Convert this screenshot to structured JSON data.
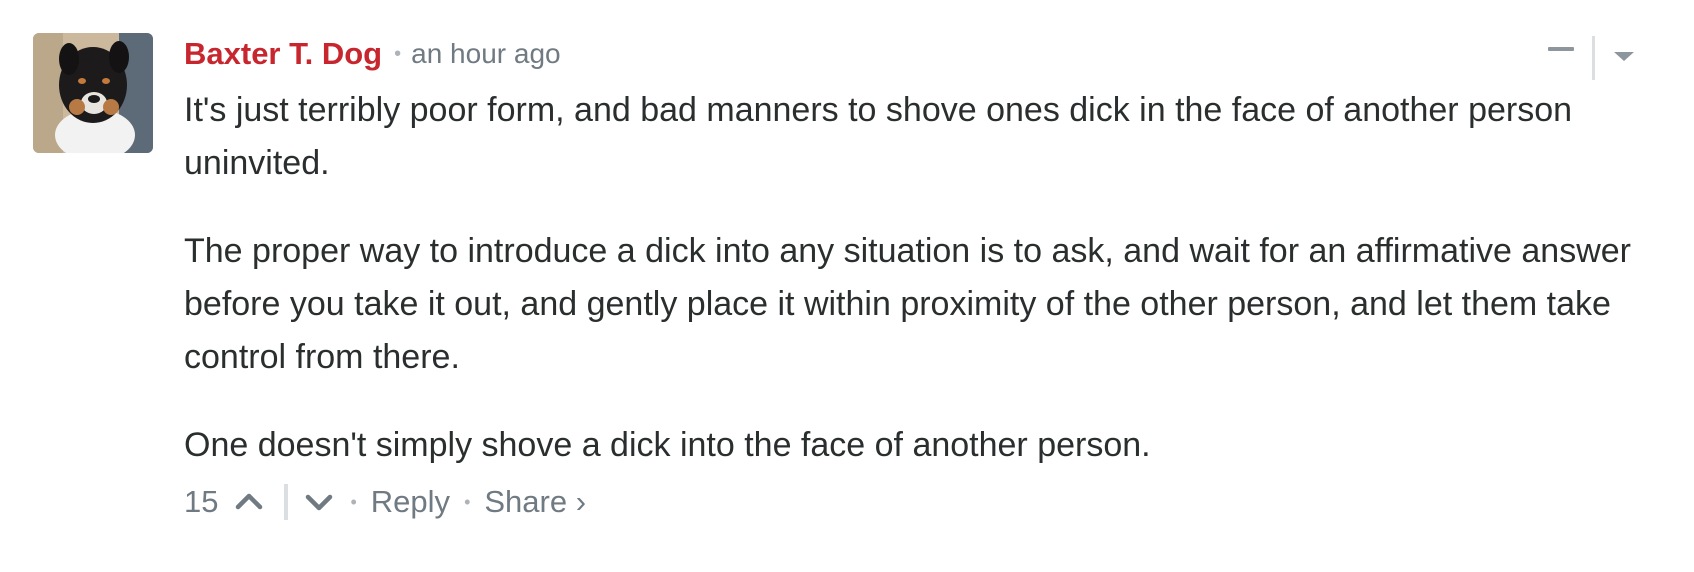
{
  "comment": {
    "author": "Baxter T. Dog",
    "separator": "•",
    "timestamp": "an hour ago",
    "paragraphs": [
      "It's just terribly poor form, and bad manners to shove ones dick in the face of another person uninvited.",
      "The proper way to introduce a dick into any situation is to ask, and wait for an affirmative answer before you take it out, and gently place it within proximity of the other person, and let them take control from there.",
      "One doesn't simply shove a dick into the face of another person."
    ],
    "footer": {
      "upvotes": "15",
      "dot": "•",
      "reply_label": "Reply",
      "share_label": "Share ›"
    }
  },
  "colors": {
    "author": "#c8262e",
    "meta": "#707a82",
    "text": "#2a2e2e",
    "divider": "#dcdfe2"
  },
  "icons": {
    "avatar": "dog-avatar",
    "collapse": "minus-icon",
    "menu": "caret-down-icon",
    "upvote": "chevron-up-icon",
    "downvote": "chevron-down-icon"
  }
}
